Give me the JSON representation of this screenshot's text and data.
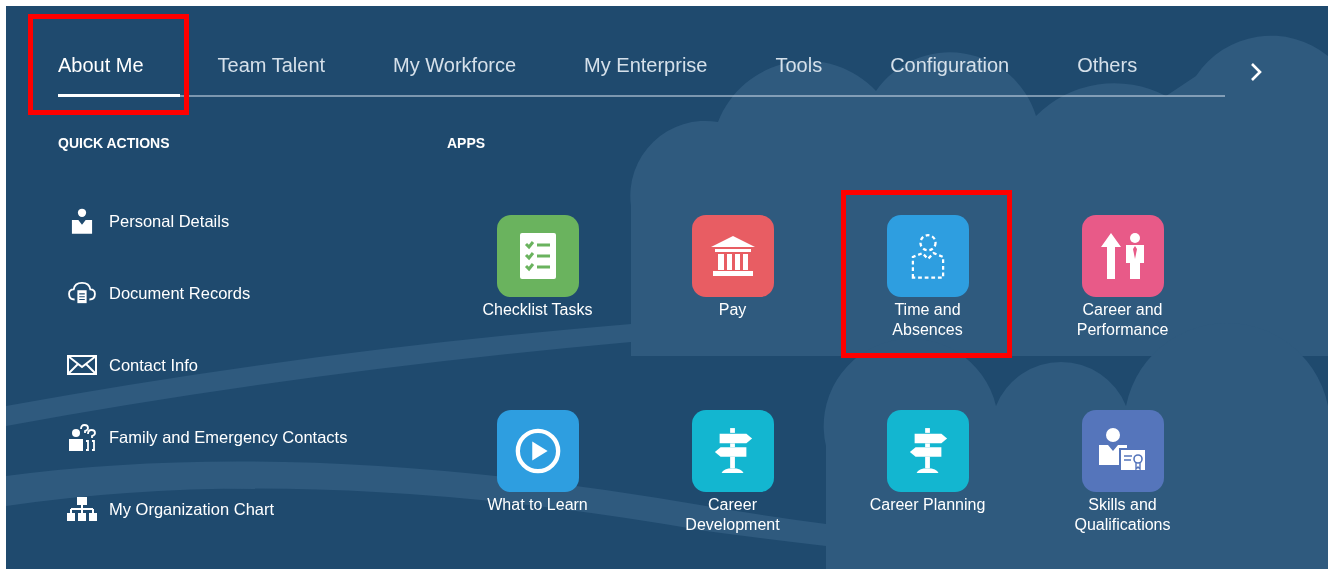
{
  "tabs": [
    {
      "label": "About Me",
      "selected": true,
      "highlighted": true
    },
    {
      "label": "Team Talent",
      "selected": false,
      "highlighted": false
    },
    {
      "label": "My Workforce",
      "selected": false,
      "highlighted": false
    },
    {
      "label": "My Enterprise",
      "selected": false,
      "highlighted": false
    },
    {
      "label": "Tools",
      "selected": false,
      "highlighted": false
    },
    {
      "label": "Configuration",
      "selected": false,
      "highlighted": false
    },
    {
      "label": "Others",
      "selected": false,
      "highlighted": false
    }
  ],
  "quick_actions": {
    "heading": "QUICK ACTIONS",
    "items": [
      {
        "label": "Personal Details"
      },
      {
        "label": "Document Records"
      },
      {
        "label": "Contact Info"
      },
      {
        "label": "Family and Emergency Contacts"
      },
      {
        "label": "My Organization Chart"
      }
    ]
  },
  "apps": {
    "heading": "APPS",
    "items": [
      {
        "label": "Checklist Tasks",
        "color": "#6ab35e",
        "highlighted": false
      },
      {
        "label": "Pay",
        "color": "#e85d63",
        "highlighted": false
      },
      {
        "label": "Time and Absences",
        "color": "#2e9ee0",
        "highlighted": true
      },
      {
        "label": "Career and Performance",
        "color": "#e85a88",
        "highlighted": false
      },
      {
        "label": "What to Learn",
        "color": "#2e9ee0",
        "highlighted": false
      },
      {
        "label": "Career Development",
        "color": "#13b6d0",
        "highlighted": false
      },
      {
        "label": "Career Planning",
        "color": "#13b6d0",
        "highlighted": false
      },
      {
        "label": "Skills and Qualifications",
        "color": "#5575bb",
        "highlighted": false
      }
    ]
  }
}
